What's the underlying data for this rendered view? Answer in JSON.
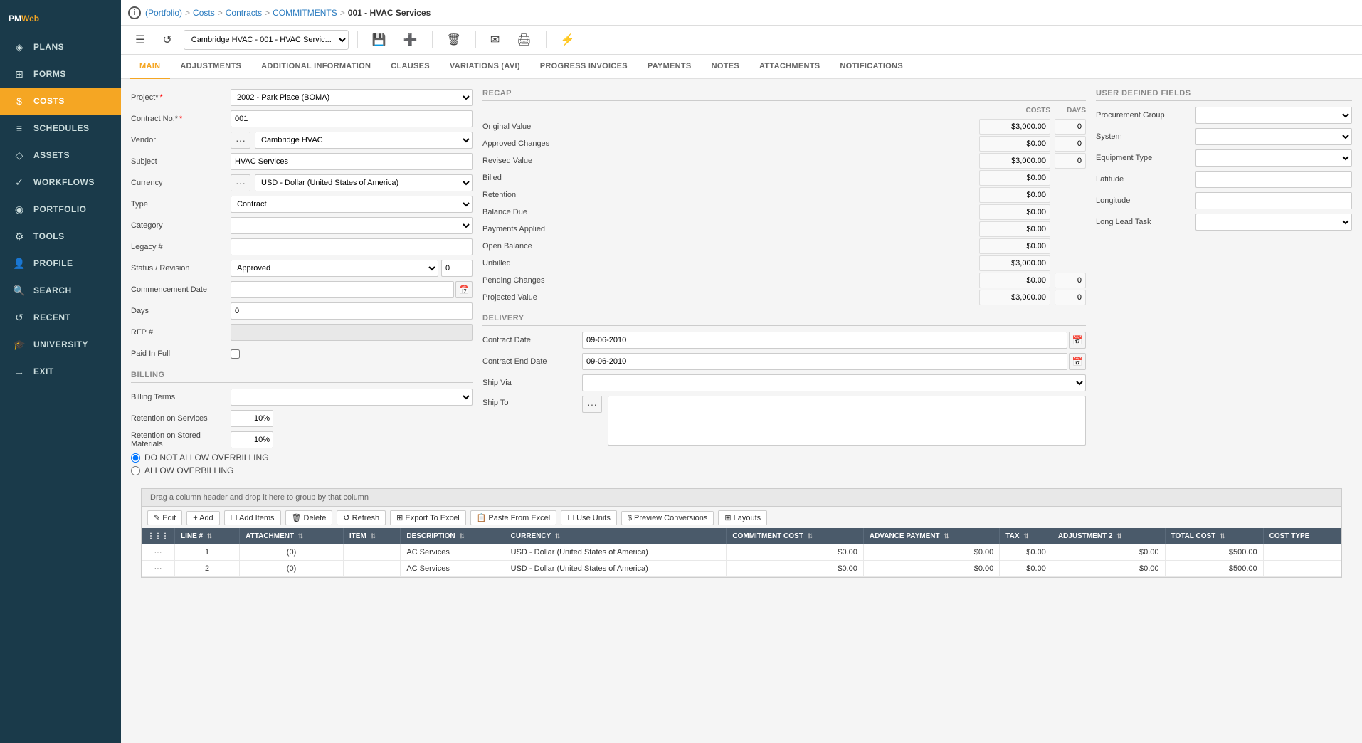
{
  "app": {
    "name": "PMWeb",
    "logo_pm": "PM",
    "logo_web": "Web"
  },
  "breadcrumb": {
    "portfolio": "(Portfolio)",
    "costs": "Costs",
    "contracts": "Contracts",
    "commitments": "COMMITMENTS",
    "current": "001 - HVAC Services"
  },
  "toolbar": {
    "record_selector": "Cambridge HVAC - 001 - HVAC Servic..."
  },
  "tabs": [
    {
      "label": "MAIN",
      "active": true
    },
    {
      "label": "ADJUSTMENTS",
      "active": false
    },
    {
      "label": "ADDITIONAL INFORMATION",
      "active": false
    },
    {
      "label": "CLAUSES",
      "active": false
    },
    {
      "label": "VARIATIONS (AVI)",
      "active": false
    },
    {
      "label": "PROGRESS INVOICES",
      "active": false
    },
    {
      "label": "PAYMENTS",
      "active": false
    },
    {
      "label": "NOTES",
      "active": false
    },
    {
      "label": "ATTACHMENTS",
      "active": false
    },
    {
      "label": "NOTIFICATIONS",
      "active": false
    }
  ],
  "nav": [
    {
      "label": "PLANS",
      "icon": "◈",
      "active": false
    },
    {
      "label": "FORMS",
      "icon": "⊞",
      "active": false
    },
    {
      "label": "COSTS",
      "icon": "$",
      "active": true
    },
    {
      "label": "SCHEDULES",
      "icon": "≡",
      "active": false
    },
    {
      "label": "ASSETS",
      "icon": "◇",
      "active": false
    },
    {
      "label": "WORKFLOWS",
      "icon": "✓",
      "active": false
    },
    {
      "label": "PORTFOLIO",
      "icon": "◉",
      "active": false
    },
    {
      "label": "TOOLS",
      "icon": "⚙",
      "active": false
    },
    {
      "label": "PROFILE",
      "icon": "👤",
      "active": false
    },
    {
      "label": "SEARCH",
      "icon": "🔍",
      "active": false
    },
    {
      "label": "RECENT",
      "icon": "↺",
      "active": false
    },
    {
      "label": "UNIVERSITY",
      "icon": "🎓",
      "active": false
    },
    {
      "label": "EXIT",
      "icon": "→",
      "active": false
    }
  ],
  "form": {
    "project_label": "Project*",
    "project_value": "2002 - Park Place (BOMA)",
    "contract_no_label": "Contract No.*",
    "contract_no_value": "001",
    "vendor_label": "Vendor",
    "vendor_value": "Cambridge HVAC",
    "subject_label": "Subject",
    "subject_value": "HVAC Services",
    "currency_label": "Currency",
    "currency_value": "USD - Dollar (United States of America)",
    "type_label": "Type",
    "type_value": "Contract",
    "category_label": "Category",
    "category_value": "",
    "legacy_label": "Legacy #",
    "legacy_value": "",
    "status_label": "Status / Revision",
    "status_value": "Approved",
    "status_num": "0",
    "commencement_label": "Commencement Date",
    "commencement_value": "",
    "days_label": "Days",
    "days_value": "0",
    "rfp_label": "RFP #",
    "rfp_value": "",
    "paid_full_label": "Paid In Full"
  },
  "recap": {
    "title": "RECAP",
    "costs_header": "COSTS",
    "days_header": "DAYS",
    "rows": [
      {
        "label": "Original Value",
        "costs": "$3,000.00",
        "days": "0"
      },
      {
        "label": "Approved Changes",
        "costs": "$0.00",
        "days": "0"
      },
      {
        "label": "Revised Value",
        "costs": "$3,000.00",
        "days": "0"
      },
      {
        "label": "Billed",
        "costs": "$0.00",
        "days": null
      },
      {
        "label": "Retention",
        "costs": "$0.00",
        "days": null
      },
      {
        "label": "Balance Due",
        "costs": "$0.00",
        "days": null
      },
      {
        "label": "Payments Applied",
        "costs": "$0.00",
        "days": null
      },
      {
        "label": "Open Balance",
        "costs": "$0.00",
        "days": null
      },
      {
        "label": "Unbilled",
        "costs": "$3,000.00",
        "days": null
      },
      {
        "label": "Pending Changes",
        "costs": "$0.00",
        "days": "0"
      },
      {
        "label": "Projected Value",
        "costs": "$3,000.00",
        "days": "0"
      }
    ]
  },
  "delivery": {
    "title": "DELIVERY",
    "contract_date_label": "Contract Date",
    "contract_date_value": "09-06-2010",
    "contract_end_label": "Contract End Date",
    "contract_end_value": "09-06-2010",
    "ship_via_label": "Ship Via",
    "ship_via_value": "",
    "ship_to_label": "Ship To",
    "ship_to_value": ""
  },
  "billing": {
    "title": "BILLING",
    "billing_terms_label": "Billing Terms",
    "billing_terms_value": "",
    "retention_services_label": "Retention on Services",
    "retention_services_value": "10%",
    "retention_stored_label": "Retention on Stored Materials",
    "retention_stored_value": "10%",
    "radio_no_overbilling": "DO NOT ALLOW OVERBILLING",
    "radio_allow_overbilling": "ALLOW OVERBILLING"
  },
  "udf": {
    "title": "USER DEFINED FIELDS",
    "procurement_group_label": "Procurement Group",
    "system_label": "System",
    "equipment_type_label": "Equipment Type",
    "latitude_label": "Latitude",
    "longitude_label": "Longitude",
    "long_lead_task_label": "Long Lead Task"
  },
  "grid": {
    "drag_hint": "Drag a column header and drop it here to group by that column",
    "toolbar_buttons": [
      "Edit",
      "Add",
      "Add Items",
      "Delete",
      "Refresh",
      "Export To Excel",
      "Paste From Excel",
      "Use Units",
      "Preview Conversions",
      "Layouts"
    ],
    "columns": [
      "",
      "LINE #",
      "ATTACHMENT",
      "ITEM",
      "DESCRIPTION",
      "CURRENCY",
      "COMMITMENT COST",
      "ADVANCE PAYMENT",
      "TAX",
      "ADJUSTMENT 2",
      "TOTAL COST",
      "COST TYPE"
    ],
    "rows": [
      {
        "dots": "···",
        "line": "1",
        "attachment": "(0)",
        "item": "",
        "description": "AC Services",
        "currency": "USD - Dollar (United States of America)",
        "commitment": "$0.00",
        "advance": "$0.00",
        "tax": "$0.00",
        "adj2": "$0.00",
        "total": "$500.00",
        "cost_type": ""
      },
      {
        "dots": "···",
        "line": "2",
        "attachment": "(0)",
        "item": "",
        "description": "AC Services",
        "currency": "USD - Dollar (United States of America)",
        "commitment": "$0.00",
        "advance": "$0.00",
        "tax": "$0.00",
        "adj2": "$0.00",
        "total": "$500.00",
        "cost_type": ""
      }
    ]
  }
}
